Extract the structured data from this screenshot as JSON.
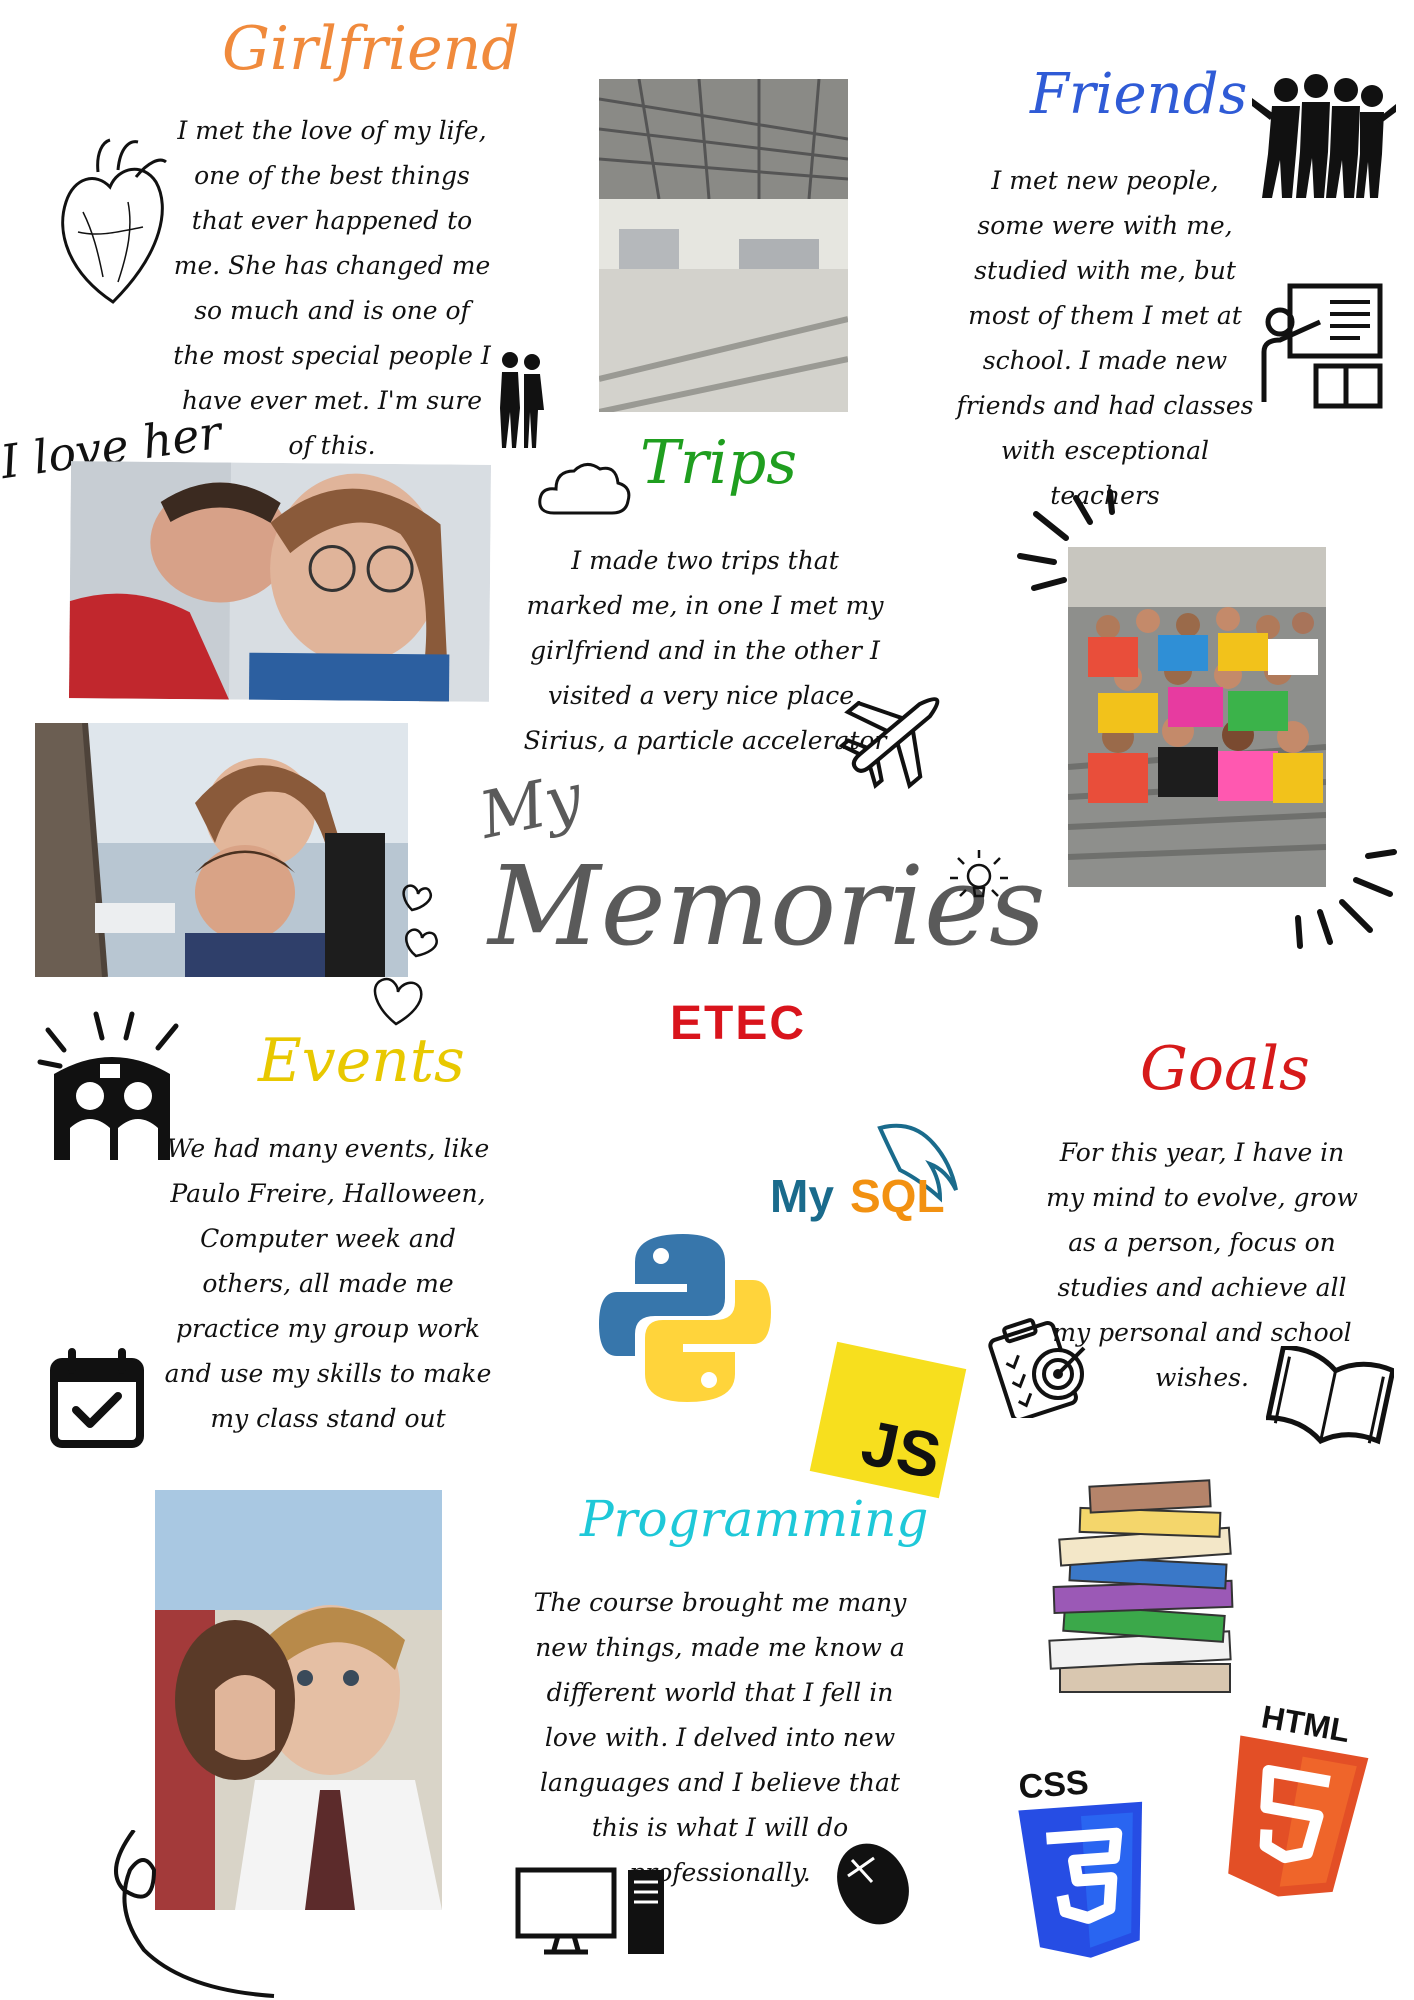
{
  "title": {
    "small": "My",
    "big": "Memories",
    "school": "ETEC"
  },
  "colors": {
    "girlfriend": "#f08a3c",
    "friends": "#2f5bd6",
    "trips": "#1f9e1f",
    "events": "#e8c800",
    "goals": "#d61a1a",
    "programming": "#1ec8d8",
    "etec": "#d9141c",
    "title": "#5a5a5a"
  },
  "sections": {
    "girlfriend": {
      "heading": "Girlfriend",
      "text": "I met the love of my life, one of the best things that ever happened to me. She has changed me so much and is one of the most special people I have ever met. I'm sure of this."
    },
    "friends": {
      "heading": "Friends",
      "text": "I met new people, some were with me, studied with me, but most of them I met at school. I made new friends and had classes with esceptional teachers"
    },
    "trips": {
      "heading": "Trips",
      "text": "I made two trips that marked me, in one I met my girlfriend and in the other I visited a very nice place, Sirius, a particle accelerator"
    },
    "events": {
      "heading": "Events",
      "text": "We had many events, like Paulo Freire, Halloween, Computer week and others, all made me practice my group work and use my skills to make my class stand out"
    },
    "goals": {
      "heading": "Goals",
      "text": "For this year, I have in my mind to evolve, grow as a person, focus on studies and achieve all my personal and school wishes."
    },
    "programming": {
      "heading": "Programming",
      "text": "The course brought me many new things, made me know a different world that I fell in love with. I delved into new languages and I believe that this is what I will do professionally."
    }
  },
  "love_caption": "I love her",
  "logos": {
    "mysql_a": "My",
    "mysql_b": "SQL",
    "js": "JS",
    "css": "CSS",
    "html": "HTML"
  },
  "icons": [
    "heart-anatomy-icon",
    "couple-silhouette-icon",
    "friends-group-icon",
    "teacher-board-icon",
    "cloud-icon",
    "airplane-icon",
    "lightbulb-icon",
    "hearts-icon",
    "calendar-check-icon",
    "goal-clipboard-icon",
    "open-book-icon",
    "books-stack-icon",
    "computer-icon",
    "mouse-icon",
    "python-logo-icon",
    "mysql-logo-icon",
    "javascript-logo-icon",
    "css3-logo-icon",
    "html5-logo-icon"
  ]
}
